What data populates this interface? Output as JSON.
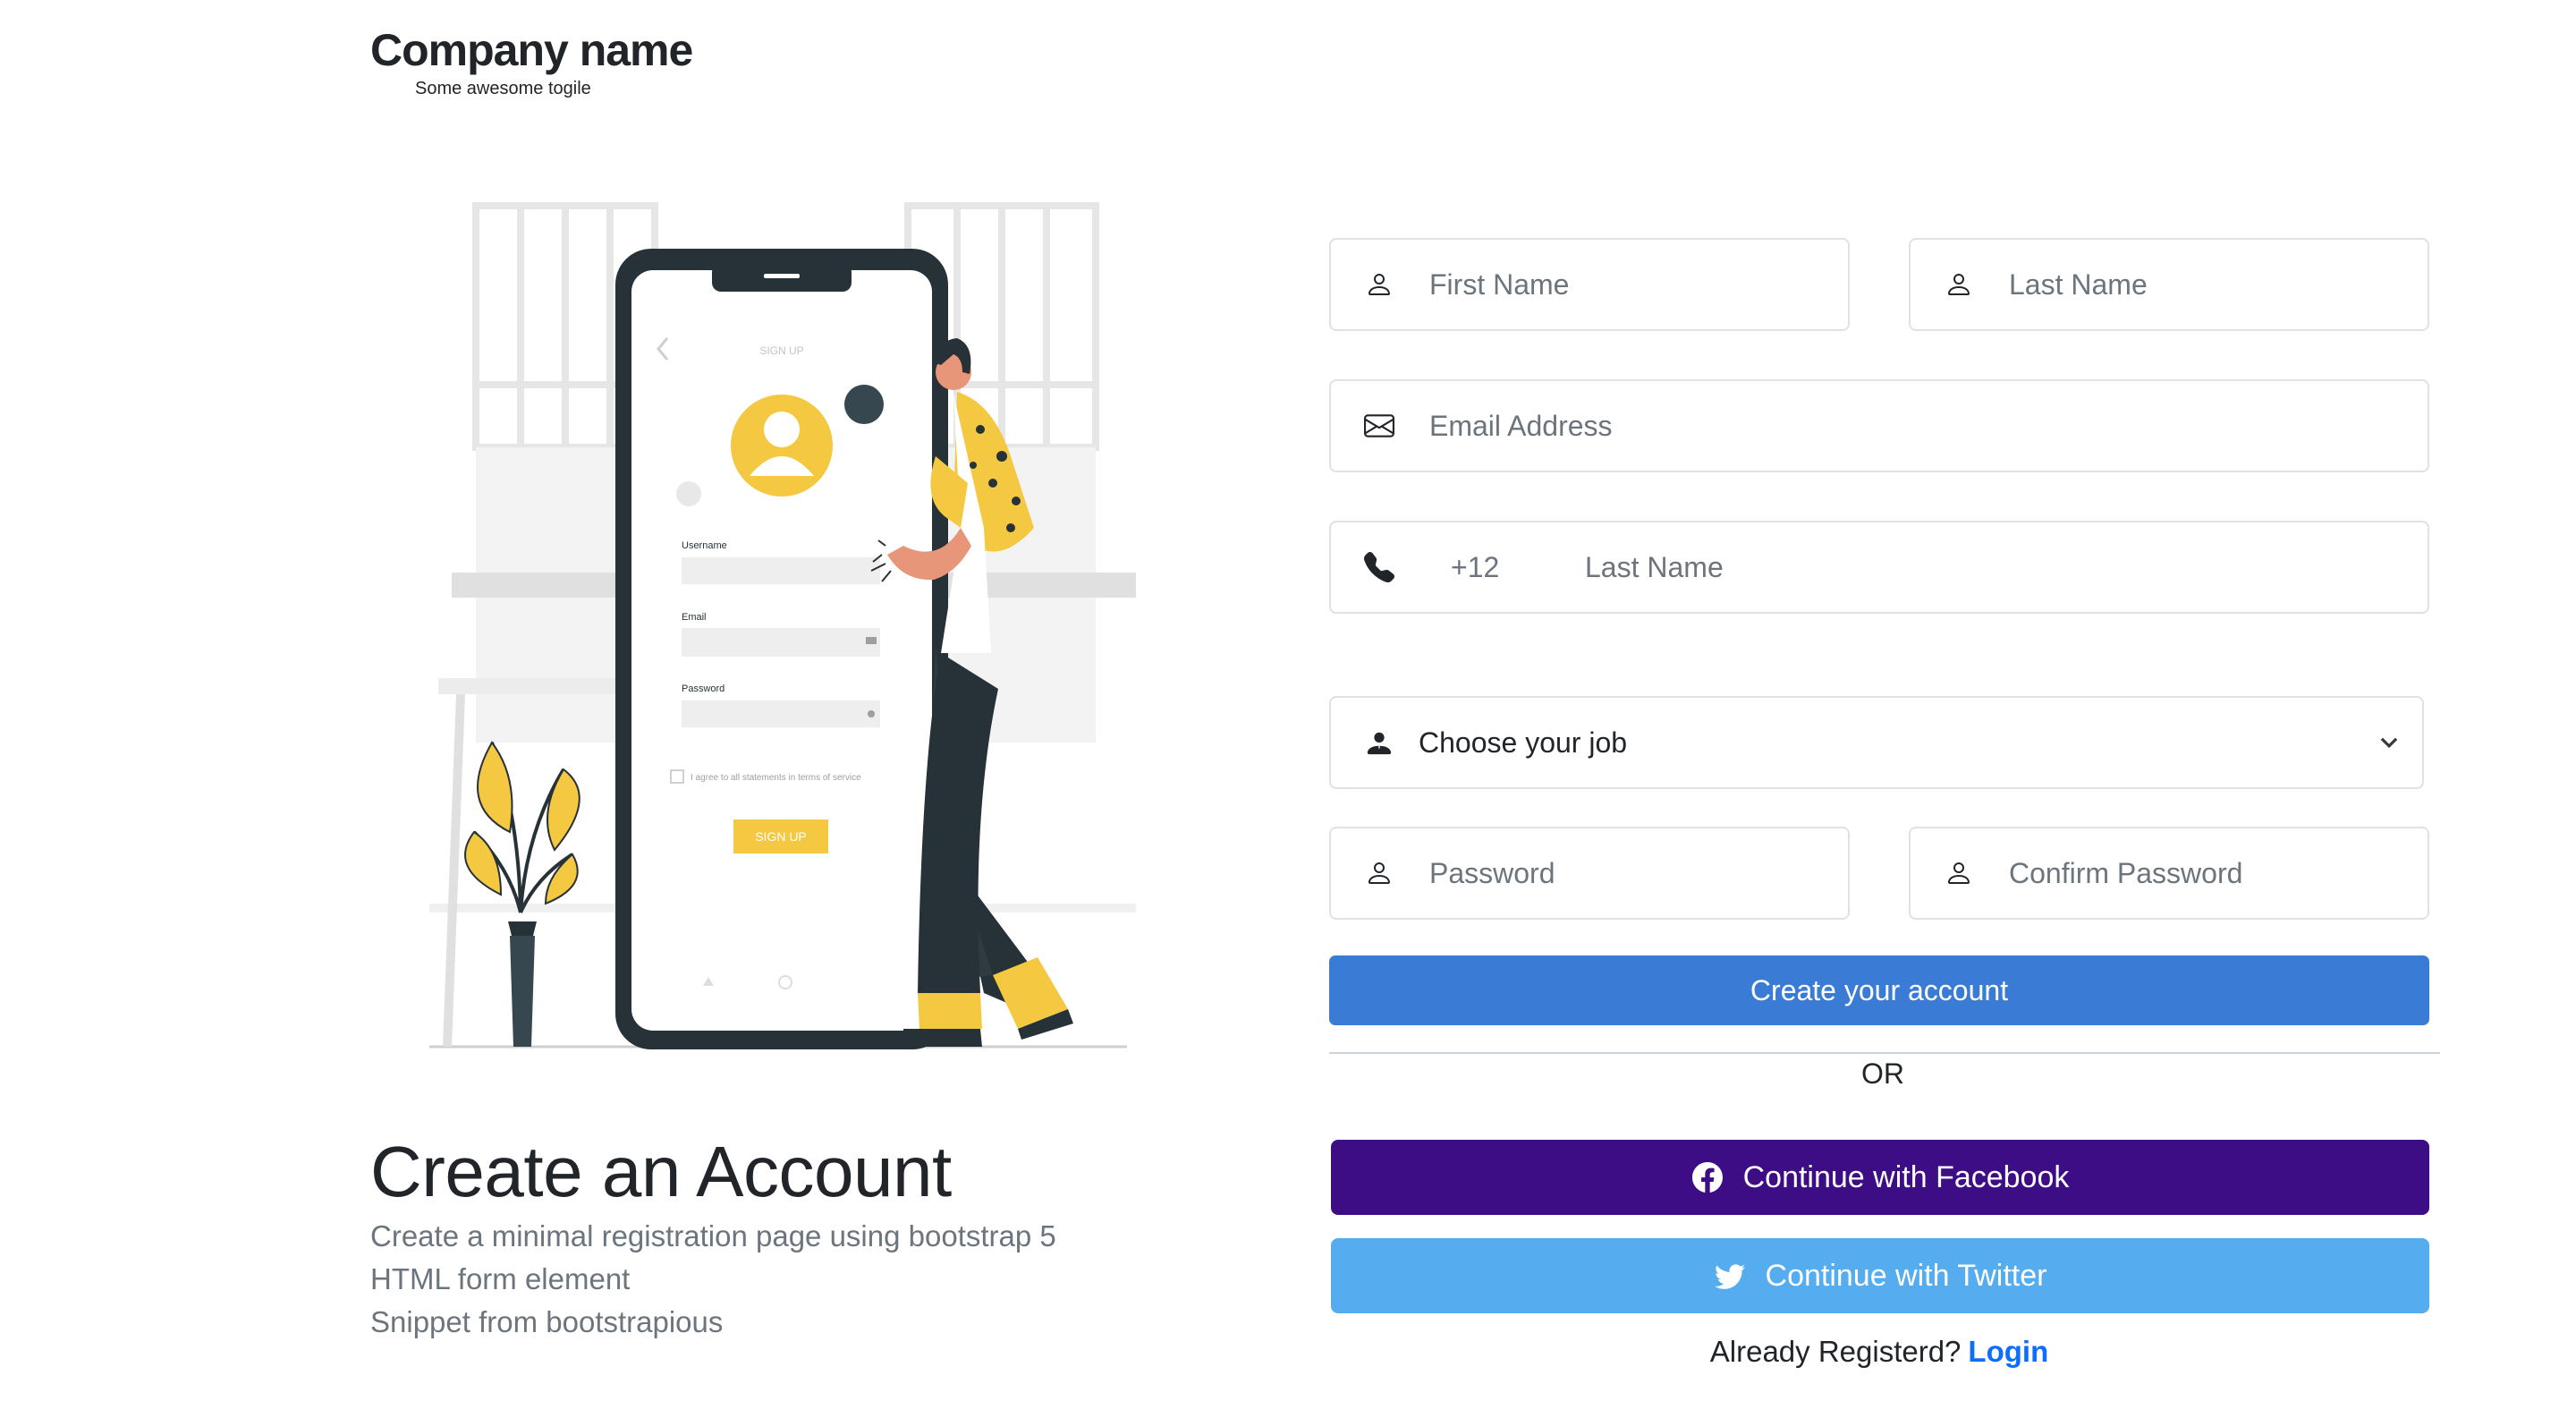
{
  "brand": {
    "title": "Company name",
    "subtitle": "Some awesome togile"
  },
  "illustration": {
    "phone_title": "SIGN UP",
    "username_label": "Username",
    "email_label": "Email",
    "password_label": "Password",
    "terms_text": "I agree to all statements in terms of service",
    "signup_button": "SIGN UP",
    "colors": {
      "accent": "#f5c842",
      "dark": "#263238",
      "skin": "#e8967a"
    }
  },
  "intro": {
    "title": "Create an Account",
    "lines": [
      "Create a minimal registration page using bootstrap 5",
      "HTML form element",
      "Snippet from bootstrapious"
    ]
  },
  "form": {
    "first_name_placeholder": "First Name",
    "last_name_placeholder": "Last Name",
    "email_placeholder": "Email Address",
    "phone_code": "+12",
    "phone_placeholder": "Last Name",
    "job_selected": "Choose your job",
    "password_placeholder": "Password",
    "confirm_password_placeholder": "Confirm Password",
    "submit_label": "Create your account"
  },
  "divider": {
    "label": "OR"
  },
  "social": {
    "facebook_label": "Continue with Facebook",
    "twitter_label": "Continue with Twitter",
    "facebook_color": "#3d0d85",
    "twitter_color": "#55acee"
  },
  "login": {
    "prompt": "Already Registerd?",
    "link": "Login",
    "link_color": "#0d6efd"
  },
  "colors": {
    "primary": "#3a7bd5",
    "muted": "#6c757d",
    "border": "#dee2e6"
  }
}
